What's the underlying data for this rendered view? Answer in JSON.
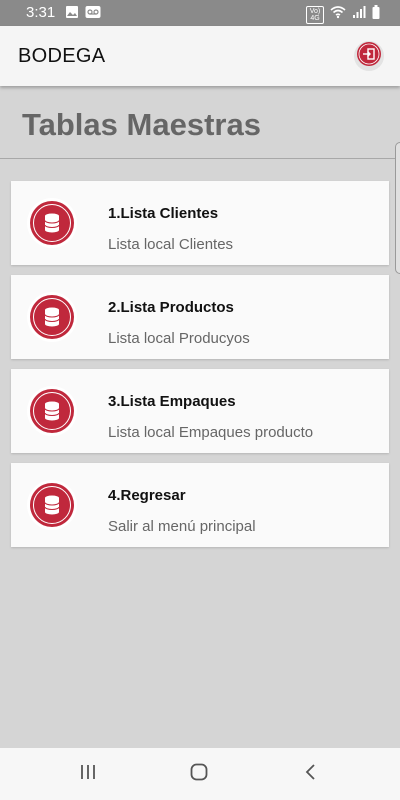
{
  "status_bar": {
    "time": "3:31",
    "left_icons": [
      "image-icon",
      "voicemail-icon"
    ],
    "right_icons": [
      "volte-icon",
      "wifi-icon",
      "signal-icon",
      "battery-icon"
    ],
    "volte_text": "Vo) 4G"
  },
  "app_bar": {
    "title": "BODEGA",
    "exit_icon": "exit-icon"
  },
  "page": {
    "title": "Tablas Maestras"
  },
  "menu": {
    "items": [
      {
        "title": "1.Lista Clientes",
        "subtitle": "Lista local Clientes",
        "icon": "database-icon"
      },
      {
        "title": "2.Lista Productos",
        "subtitle": "Lista local Producyos",
        "icon": "database-icon"
      },
      {
        "title": "3.Lista Empaques",
        "subtitle": "Lista local Empaques producto",
        "icon": "database-icon"
      },
      {
        "title": "4.Regresar",
        "subtitle": "Salir al menú principal",
        "icon": "database-icon"
      }
    ]
  },
  "nav_bar": {
    "icons": [
      "recent-apps-icon",
      "home-icon",
      "back-icon"
    ]
  },
  "colors": {
    "accent": "#c0283c",
    "status_bar": "#8a8a8a",
    "background": "#d5d5d5"
  }
}
